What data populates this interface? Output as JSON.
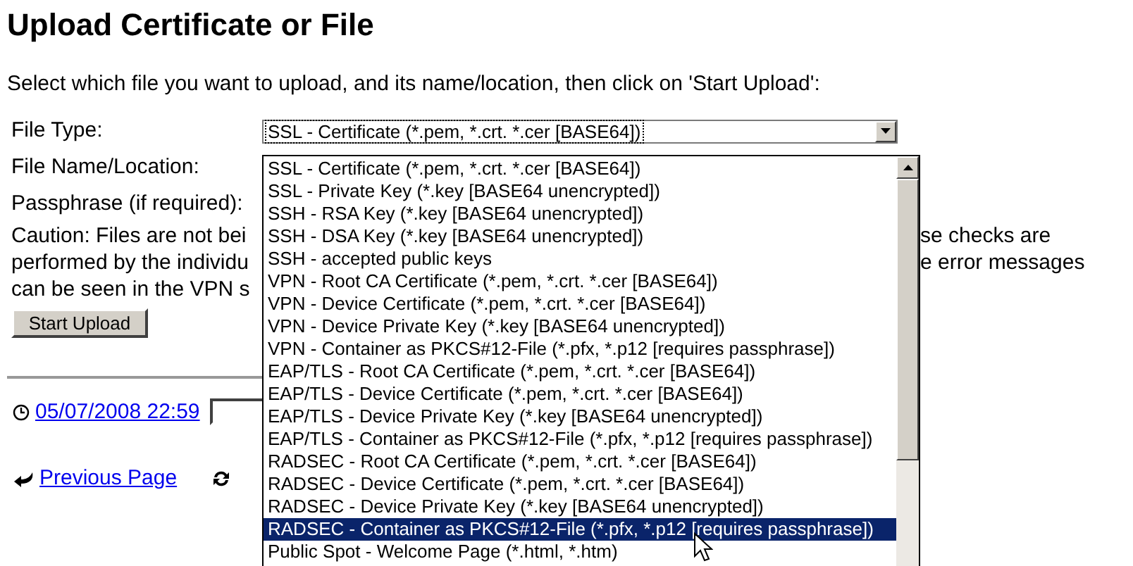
{
  "title": "Upload Certificate or File",
  "intro": "Select which file you want to upload, and its name/location, then click on 'Start Upload':",
  "form": {
    "file_type_label": "File Type:",
    "file_type_value": "SSL - Certificate (*.pem, *.crt. *.cer [BASE64])",
    "file_name_label": "File Name/Location:",
    "passphrase_label": "Passphrase (if required):"
  },
  "caution_lines": [
    {
      "left": "Caution: Files are not bei",
      "right": "se checks are"
    },
    {
      "left": "performed by the individu",
      "right": "e error messages"
    },
    {
      "left": "can be seen in the VPN s"
    }
  ],
  "upload_button": "Start Upload",
  "timestamp_link": "05/07/2008 22:59",
  "previous_page_link": "Previous Page",
  "dropdown_options": [
    {
      "label": "SSL - Certificate (*.pem, *.crt. *.cer [BASE64])",
      "selected": false
    },
    {
      "label": "SSL - Private Key (*.key [BASE64 unencrypted])",
      "selected": false
    },
    {
      "label": "SSH - RSA Key (*.key [BASE64 unencrypted])",
      "selected": false
    },
    {
      "label": "SSH - DSA Key (*.key [BASE64 unencrypted])",
      "selected": false
    },
    {
      "label": "SSH - accepted public keys",
      "selected": false
    },
    {
      "label": "VPN - Root CA Certificate (*.pem, *.crt. *.cer [BASE64])",
      "selected": false
    },
    {
      "label": "VPN - Device Certificate (*.pem, *.crt. *.cer [BASE64])",
      "selected": false
    },
    {
      "label": "VPN - Device Private Key (*.key [BASE64 unencrypted])",
      "selected": false
    },
    {
      "label": "VPN - Container as PKCS#12-File (*.pfx, *.p12 [requires passphrase])",
      "selected": false
    },
    {
      "label": "EAP/TLS - Root CA Certificate (*.pem, *.crt. *.cer [BASE64])",
      "selected": false
    },
    {
      "label": "EAP/TLS - Device Certificate (*.pem, *.crt. *.cer [BASE64])",
      "selected": false
    },
    {
      "label": "EAP/TLS - Device Private Key (*.key [BASE64 unencrypted])",
      "selected": false
    },
    {
      "label": "EAP/TLS - Container as PKCS#12-File (*.pfx, *.p12 [requires passphrase])",
      "selected": false
    },
    {
      "label": "RADSEC - Root CA Certificate (*.pem, *.crt. *.cer [BASE64])",
      "selected": false
    },
    {
      "label": "RADSEC - Device Certificate (*.pem, *.crt. *.cer [BASE64])",
      "selected": false
    },
    {
      "label": "RADSEC - Device Private Key (*.key [BASE64 unencrypted])",
      "selected": false
    },
    {
      "label": "RADSEC - Container as PKCS#12-File (*.pfx, *.p12 [requires passphrase])",
      "selected": true
    },
    {
      "label": "Public Spot - Welcome Page (*.html, *.htm)",
      "selected": false
    }
  ]
}
